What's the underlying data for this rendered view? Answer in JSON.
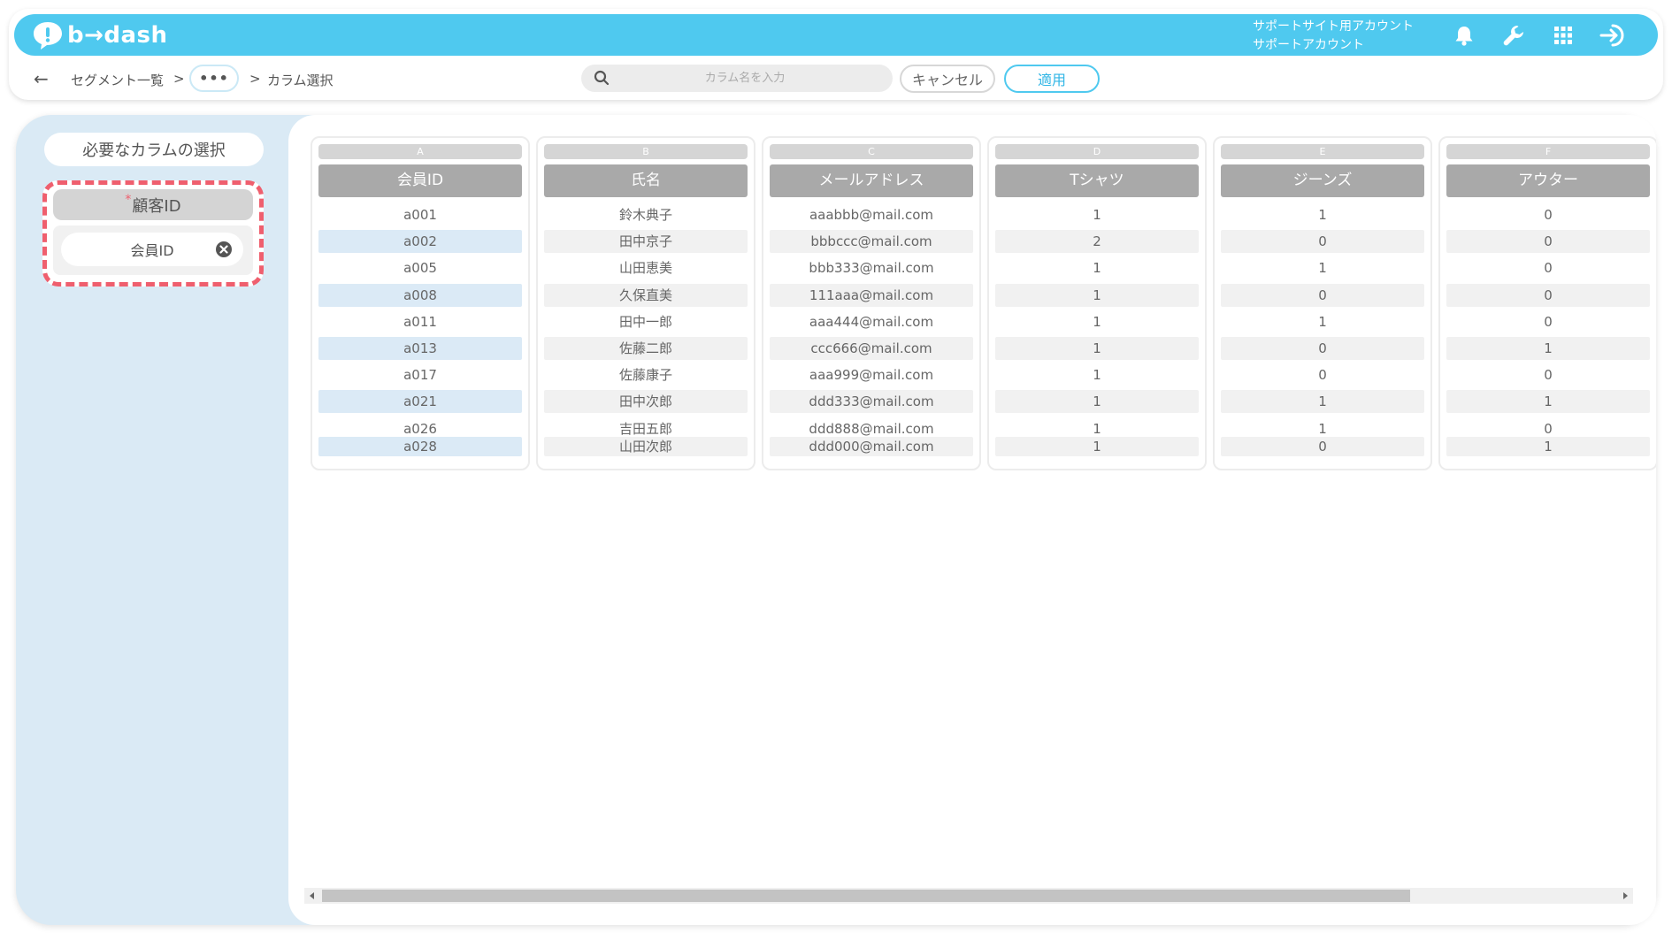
{
  "header": {
    "logo_text": "b→dash",
    "account_line1": "サポートサイト用アカウント",
    "account_line2": "サポートアカウント",
    "icons": [
      "bell-icon",
      "wrench-icon",
      "grid-icon",
      "logout-icon"
    ],
    "accent_color": "#4fc9ef"
  },
  "nav": {
    "back_icon": "←",
    "breadcrumb_segment": "セグメント一覧",
    "separator": ">",
    "more": "•••",
    "current": "カラム選択",
    "search_placeholder": "カラム名を入力",
    "cancel_label": "キャンセル",
    "apply_label": "適用"
  },
  "left_panel": {
    "title": "必要なカラムの選択",
    "required_mark": "*",
    "section_label": "顧客ID",
    "selected_column": "会員ID",
    "highlight_color": "#ef5f6e"
  },
  "table": {
    "columns": [
      {
        "letter": "A",
        "name": "会員ID",
        "values": [
          "a001",
          "a002",
          "a005",
          "a008",
          "a011",
          "a013",
          "a017",
          "a021",
          "a026",
          "a028"
        ]
      },
      {
        "letter": "B",
        "name": "氏名",
        "values": [
          "鈴木典子",
          "田中京子",
          "山田恵美",
          "久保直美",
          "田中一郎",
          "佐藤二郎",
          "佐藤康子",
          "田中次郎",
          "吉田五郎",
          "山田次郎"
        ]
      },
      {
        "letter": "C",
        "name": "メールアドレス",
        "values": [
          "aaabbb@mail.com",
          "bbbccc@mail.com",
          "bbb333@mail.com",
          "111aaa@mail.com",
          "aaa444@mail.com",
          "ccc666@mail.com",
          "aaa999@mail.com",
          "ddd333@mail.com",
          "ddd888@mail.com",
          "ddd000@mail.com"
        ]
      },
      {
        "letter": "D",
        "name": "Tシャツ",
        "values": [
          "1",
          "2",
          "1",
          "1",
          "1",
          "1",
          "1",
          "1",
          "1",
          "1"
        ]
      },
      {
        "letter": "E",
        "name": "ジーンズ",
        "values": [
          "1",
          "0",
          "1",
          "0",
          "1",
          "0",
          "0",
          "1",
          "1",
          "0"
        ]
      },
      {
        "letter": "F",
        "name": "アウター",
        "values": [
          "0",
          "0",
          "0",
          "0",
          "0",
          "1",
          "0",
          "1",
          "0",
          "1"
        ]
      }
    ]
  }
}
